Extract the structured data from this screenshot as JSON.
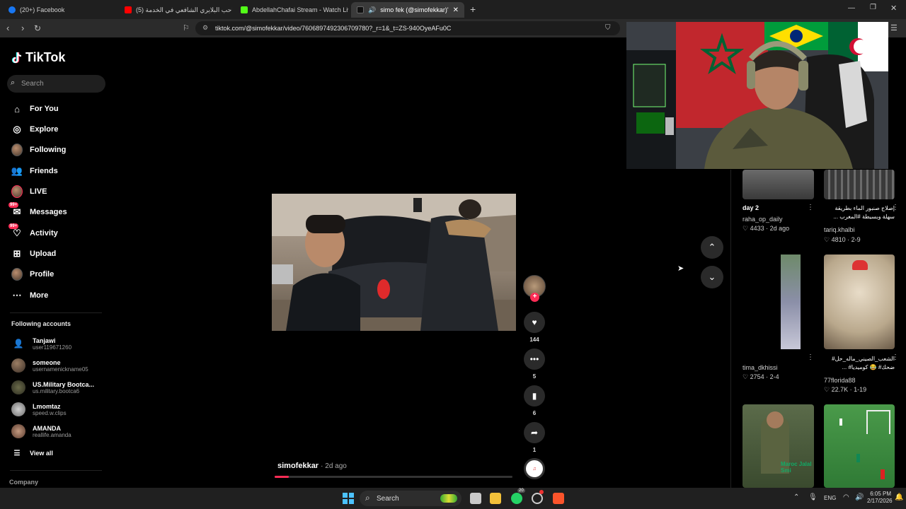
{
  "browser": {
    "tabs": [
      {
        "label": "(20+) Facebook",
        "color": "#1877f2"
      },
      {
        "label": "صاحب البلايري الشافعي في الخدمة (5)",
        "color": "#ff0000"
      },
      {
        "label": "AbdellahChafai Stream - Watch Live",
        "color": "#53fc18"
      },
      {
        "label": "simo fek (@simofekkar)'s video",
        "color": "#111111"
      }
    ],
    "url": "tiktok.com/@simofekkar/video/7606897492306709780?_r=1&_t=ZS-940OyeAFu0C"
  },
  "sidebar": {
    "logo": "TikTok",
    "search_placeholder": "Search",
    "nav": [
      {
        "label": "For You",
        "icon": "home-icon"
      },
      {
        "label": "Explore",
        "icon": "compass-icon"
      },
      {
        "label": "Following",
        "icon": "following-avatar"
      },
      {
        "label": "Friends",
        "icon": "friends-icon"
      },
      {
        "label": "LIVE",
        "icon": "live-avatar"
      },
      {
        "label": "Messages",
        "icon": "messages-icon",
        "badge": "99+"
      },
      {
        "label": "Activity",
        "icon": "activity-icon",
        "badge": "99+"
      },
      {
        "label": "Upload",
        "icon": "upload-icon"
      },
      {
        "label": "Profile",
        "icon": "profile-avatar"
      },
      {
        "label": "More",
        "icon": "more-icon"
      }
    ],
    "following_title": "Following accounts",
    "accounts": [
      {
        "name": "Tanjawi",
        "handle": "user119671260"
      },
      {
        "name": "someone",
        "handle": "usernamenickname05"
      },
      {
        "name": "US.Military Bootca...",
        "handle": "us.military.bootca6"
      },
      {
        "name": "Lmomtaz",
        "handle": "speed.w.clips"
      },
      {
        "name": "AMANDA",
        "handle": "reallife.amanda"
      }
    ],
    "view_all": "View all",
    "company": "Company"
  },
  "video": {
    "author": "simofekkar",
    "time": "· 2d ago",
    "likes": "144",
    "comments": "5",
    "saves": "6",
    "shares": "1"
  },
  "grid": [
    {
      "title": "day 2",
      "user": "raha_op_daily",
      "likes": "4433",
      "date": "2d ago"
    },
    {
      "title": "إصلاح صنبور الماء بطريقة سهلة وبسيطة #المغرب ...",
      "user": "tariq.khalbi",
      "likes": "4810",
      "date": "2-9"
    },
    {
      "title": "",
      "user": "tima_dkhissi",
      "likes": "2754",
      "date": "2-4"
    },
    {
      "title": "الشعب_الصيني_ماله_حل# ضحك# 😂 كوميديا# ...",
      "user": "77florida88",
      "likes": "22.7K",
      "date": "1-19"
    },
    {
      "overlay": "Maroc Jalal Smi"
    }
  ],
  "taskbar": {
    "search": "Search",
    "whatsapp_badge": "20",
    "lang": "ENG",
    "time": "6:05 PM",
    "date": "2/17/2026"
  }
}
